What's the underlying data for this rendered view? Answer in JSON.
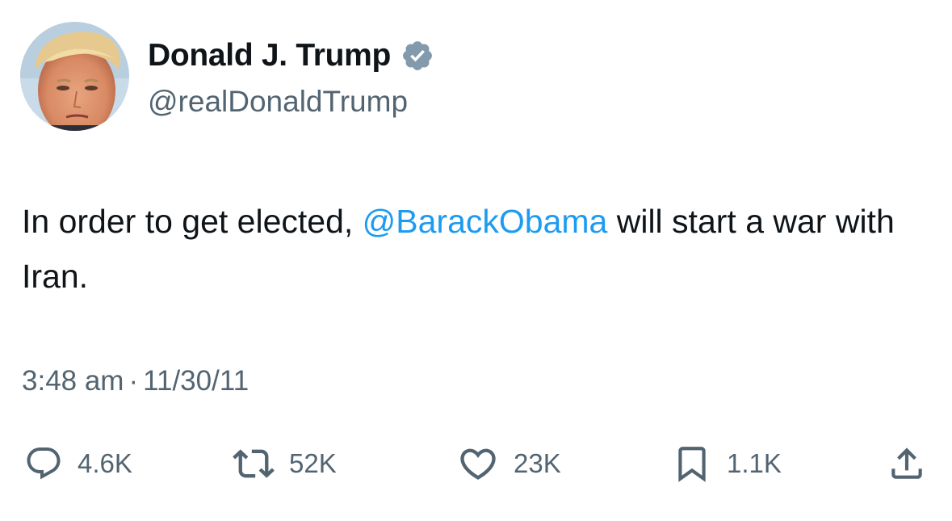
{
  "tweet": {
    "author": {
      "display_name": "Donald J. Trump",
      "handle": "@realDonaldTrump",
      "verified": true
    },
    "text": {
      "before_mention": "In order to get elected, ",
      "mention": "@BarackObama",
      "after_mention": " will start a war with Iran."
    },
    "time": "3:48 am",
    "separator": "·",
    "date": "11/30/11",
    "stats": {
      "replies": "4.6K",
      "reposts": "52K",
      "likes": "23K",
      "bookmarks": "1.1K"
    }
  },
  "icons": {
    "reply": "speech-bubble-icon",
    "repost": "repost-arrows-icon",
    "like": "heart-icon",
    "bookmark": "bookmark-icon",
    "share": "share-upload-icon",
    "verified": "verified-badge-icon"
  },
  "colors": {
    "text_primary": "#0f1419",
    "text_secondary": "#536471",
    "link": "#1d9bf0",
    "badge": "#829aab"
  }
}
